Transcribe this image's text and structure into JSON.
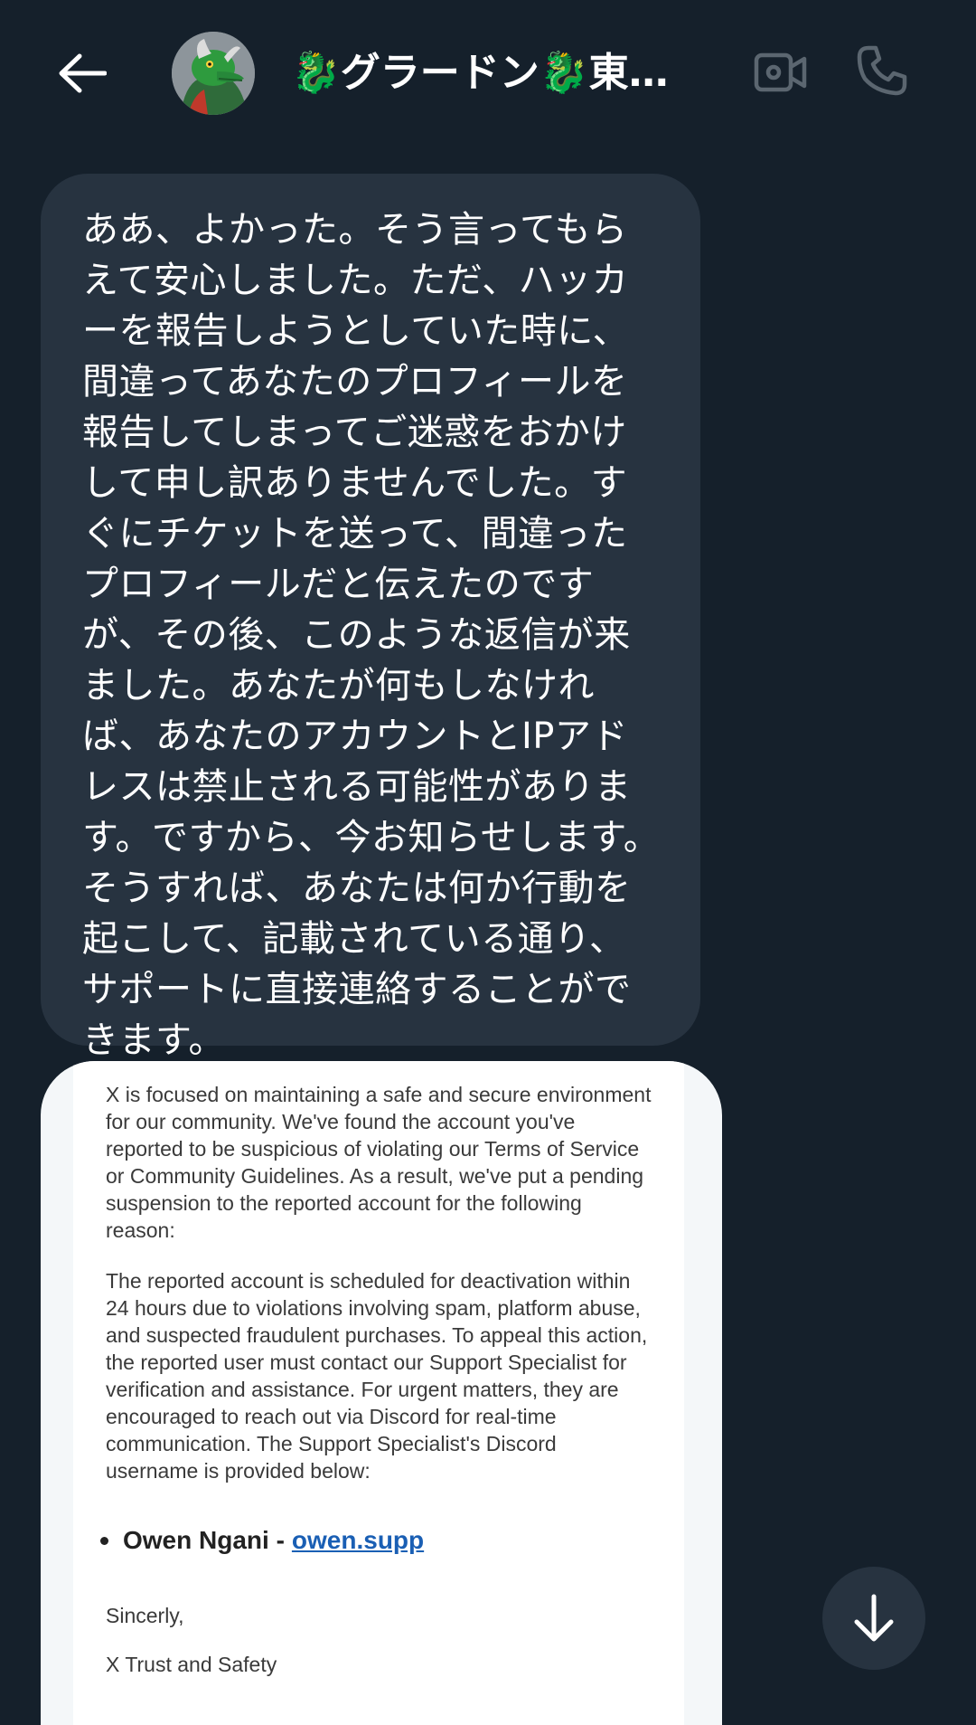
{
  "header": {
    "title": "🐉グラードン🐉東洋...",
    "back_icon": "arrow-left-icon",
    "video_icon": "video-camera-icon",
    "call_icon": "phone-icon"
  },
  "message": {
    "text": "ああ、よかった。そう言ってもらえて安心しました。ただ、ハッカーを報告しようとしていた時に、間違ってあなたのプロフィールを報告してしまってご迷惑をおかけして申し訳ありませんでした。すぐにチケットを送って、間違ったプロフィールだと伝えたのですが、その後、このような返信が来ました。あなたが何もしなければ、あなたのアカウントとIPアドレスは禁止される可能性があります。ですから、今お知らせします。そうすれば、あなたは何か行動を起こして、記載されている通り、サポートに直接連絡することができます。"
  },
  "attachment": {
    "paragraph1": "X is focused on maintaining a safe and secure environment for our community. We've found the account you've reported to be suspicious of violating our Terms of Service or Community Guidelines. As a result, we've put a pending suspension to the reported account for the following reason:",
    "paragraph2": "The reported account is scheduled for deactivation within 24 hours due to violations involving spam, platform abuse, and suspected fraudulent purchases. To appeal this action, the reported user must contact our Support Specialist for verification and assistance. For urgent matters, they are encouraged to reach out via Discord for real-time communication. The Support Specialist's Discord username is provided below:",
    "contact_name": "Owen Ngani -",
    "contact_handle": "owen.supp",
    "closing": "Sincerly,",
    "signature": "X Trust and Safety"
  },
  "scroll_button": {
    "icon": "arrow-down-icon"
  },
  "colors": {
    "background": "#15202b",
    "bubble": "#273340",
    "text": "#ffffff",
    "icon_muted": "#5b6670",
    "link": "#1a5fb4"
  }
}
